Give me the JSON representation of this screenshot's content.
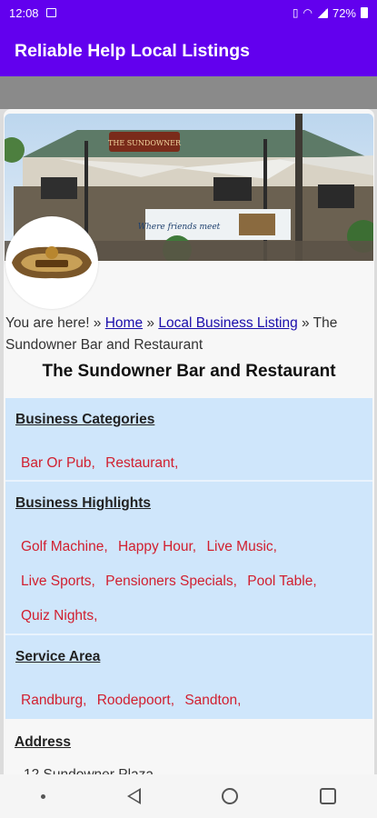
{
  "status": {
    "time": "12:08",
    "battery": "72%"
  },
  "app_bar": {
    "title": "Reliable Help Local Listings"
  },
  "hero": {
    "sign_text": "THE SUNDOWNER",
    "banner_text": "Where friends meet"
  },
  "breadcrumb": {
    "prefix": "You are here! » ",
    "home": "Home",
    "sep1": " » ",
    "listing": "Local Business Listing",
    "sep2": " » ",
    "current": "The Sundowner Bar and Restaurant"
  },
  "listing_title": "The Sundowner Bar and Restaurant",
  "categories": {
    "title": "Business Categories",
    "items": [
      "Bar Or Pub,",
      "Restaurant,"
    ]
  },
  "highlights": {
    "title": "Business Highlights",
    "items": [
      "Golf Machine,",
      "Happy Hour,",
      "Live Music,",
      "Live Sports,",
      "Pensioners Specials,",
      "Pool Table,",
      "Quiz Nights,"
    ]
  },
  "service_area": {
    "title": "Service Area",
    "items": [
      "Randburg,",
      "Roodepoort,",
      "Sandton,"
    ]
  },
  "address": {
    "title": "Address",
    "line1": "12 Sundowner Plaza"
  },
  "colors": {
    "app_bar": "#6200ee",
    "section_bg": "#cfe6fb",
    "tag_text": "#d11f2f",
    "link": "#1a0dab"
  },
  "icons": {
    "status": [
      "gallery-icon",
      "wifi-icon",
      "signal-icon",
      "battery-icon"
    ],
    "nav": [
      "nav-dot-icon",
      "back-icon",
      "home-icon",
      "recents-icon"
    ]
  }
}
